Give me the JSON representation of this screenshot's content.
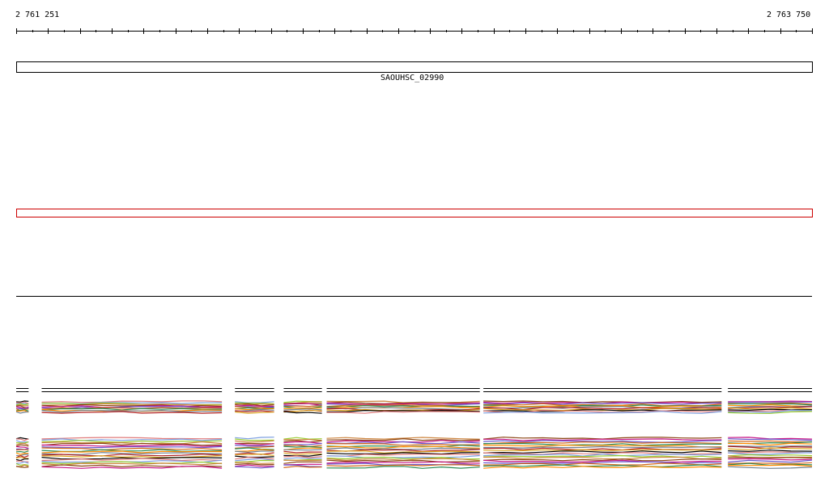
{
  "chart_data": {
    "type": "line",
    "start_label": "2 761 251",
    "end_label": "2 763 750",
    "xlim": [
      2761251,
      2763750
    ],
    "gene": {
      "name": "SAOUHSC_02990",
      "start": 2761251,
      "end": 2763750
    },
    "selection_region": {
      "start": 2761251,
      "end": 2763750,
      "color": "#cc0000"
    },
    "track_segments": [
      [
        2761251,
        2761290
      ],
      [
        2761331,
        2761897
      ],
      [
        2761938,
        2762061
      ],
      [
        2762091,
        2762211
      ],
      [
        2762226,
        2762707
      ],
      [
        2762718,
        2763466
      ],
      [
        2763486,
        2763750
      ]
    ],
    "series_colors": [
      "#000000",
      "#e07a7a",
      "#7a9ee0",
      "#9acd32",
      "#cd853f",
      "#8b4513",
      "#c71585",
      "#6a5acd",
      "#d2691e",
      "#2e8b57",
      "#ff8c00",
      "#708090",
      "#b22222",
      "#daa520"
    ]
  }
}
